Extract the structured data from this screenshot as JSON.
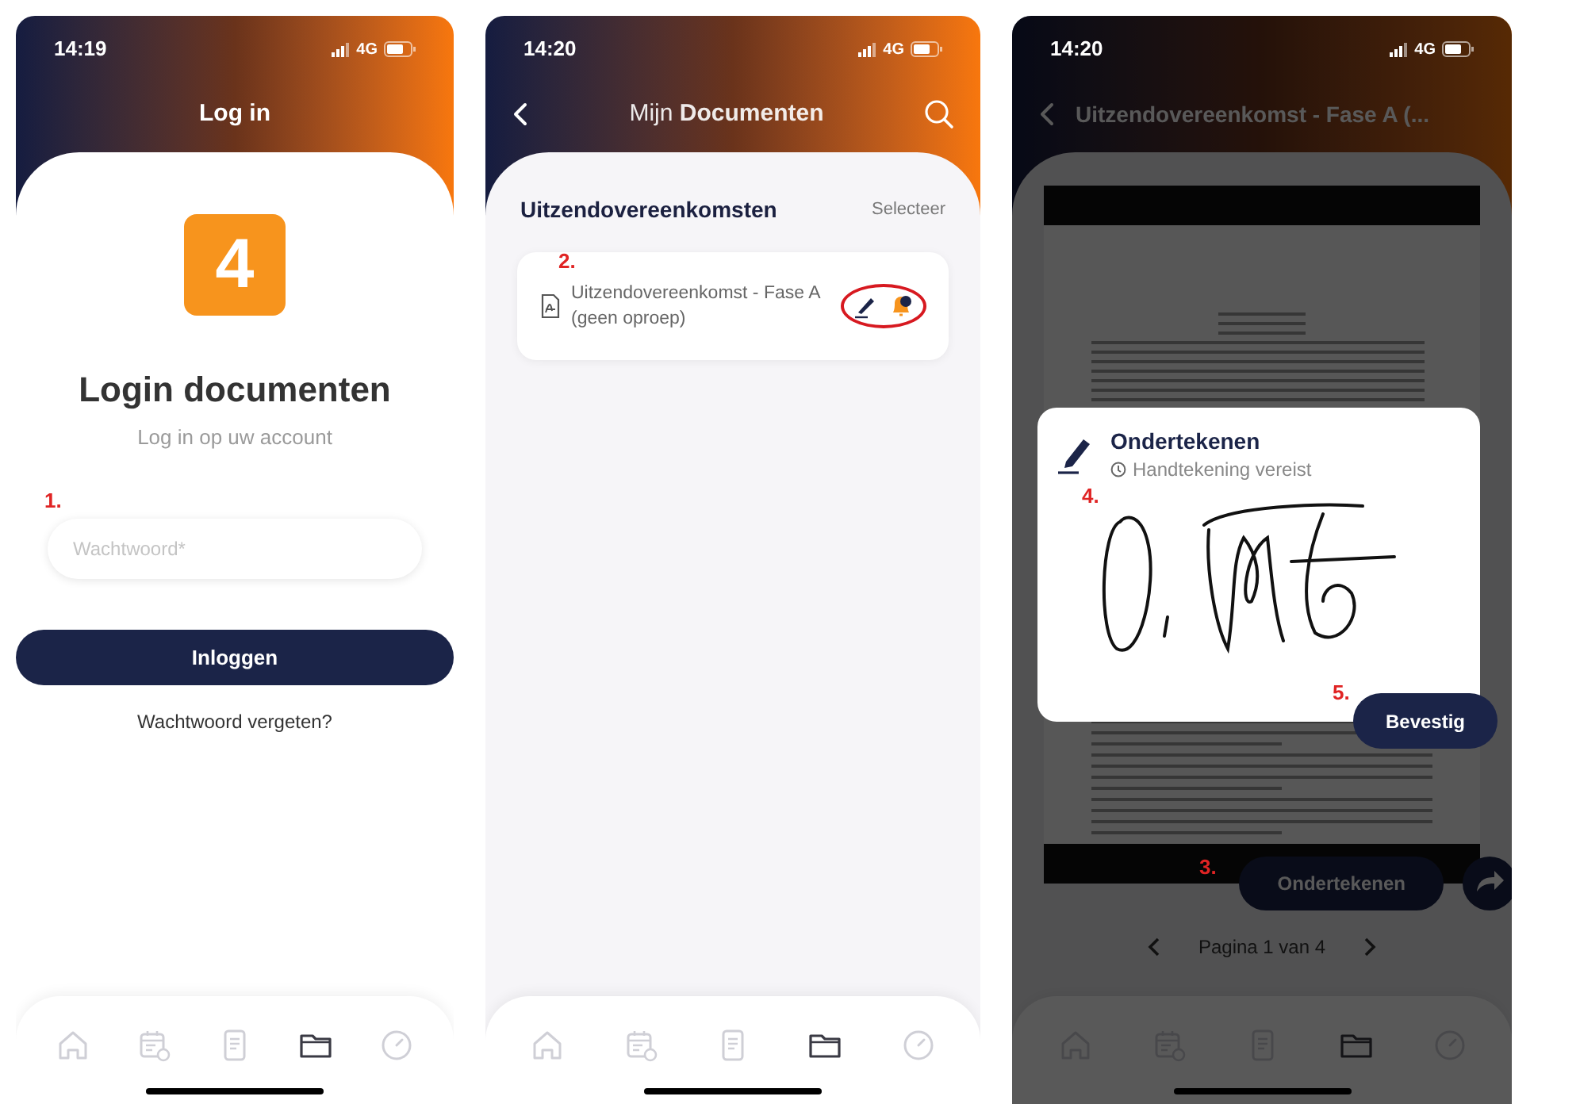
{
  "screens": [
    {
      "kind": "login",
      "status_bar": {
        "time": "14:19",
        "network": "4G"
      },
      "title": "Log in",
      "logo_text": "4",
      "heading": "Login documenten",
      "subheading": "Log in op uw account",
      "password_field": {
        "step": "1.",
        "placeholder": "Wachtwoord*"
      },
      "login_button": "Inloggen",
      "forgot_link": "Wachtwoord vergeten?",
      "tab_bar": [
        {
          "kind": "home",
          "selected": false
        },
        {
          "kind": "calendar",
          "selected": false
        },
        {
          "kind": "document",
          "selected": false
        },
        {
          "kind": "folder",
          "selected": true
        },
        {
          "kind": "gauge",
          "selected": false
        }
      ]
    },
    {
      "kind": "documents",
      "status_bar": {
        "time": "14:20",
        "network": "4G"
      },
      "title": "Mijn **Documenten**",
      "section": {
        "title": "Uitzendovereenkomsten",
        "action": "Selecteer"
      },
      "documents": [
        {
          "step": "2.",
          "name": "Uitzendovereenkomst - Fase A (geen oproep)",
          "highlighted": true
        }
      ],
      "tab_bar": [
        {
          "kind": "home",
          "selected": false
        },
        {
          "kind": "calendar",
          "selected": false
        },
        {
          "kind": "document",
          "selected": false
        },
        {
          "kind": "folder",
          "selected": true
        },
        {
          "kind": "gauge",
          "selected": false
        }
      ]
    },
    {
      "kind": "viewer",
      "status_bar": {
        "time": "14:20",
        "network": "4G"
      },
      "title": "Uitzendovereenkomst - Fase A (...",
      "sign_button": {
        "step": "3.",
        "label": "Ondertekenen"
      },
      "pager": "Pagina 1 van 4",
      "dialog": {
        "title": "Ondertekenen",
        "subtitle": "Handtekening vereist",
        "signature_step": "4.",
        "confirm_step": "5.",
        "confirm_button": "Bevestig"
      },
      "tab_bar": [
        {
          "kind": "home",
          "selected": false
        },
        {
          "kind": "calendar",
          "selected": false
        },
        {
          "kind": "document",
          "selected": false
        },
        {
          "kind": "folder",
          "selected": true
        },
        {
          "kind": "gauge",
          "selected": false
        }
      ]
    }
  ]
}
